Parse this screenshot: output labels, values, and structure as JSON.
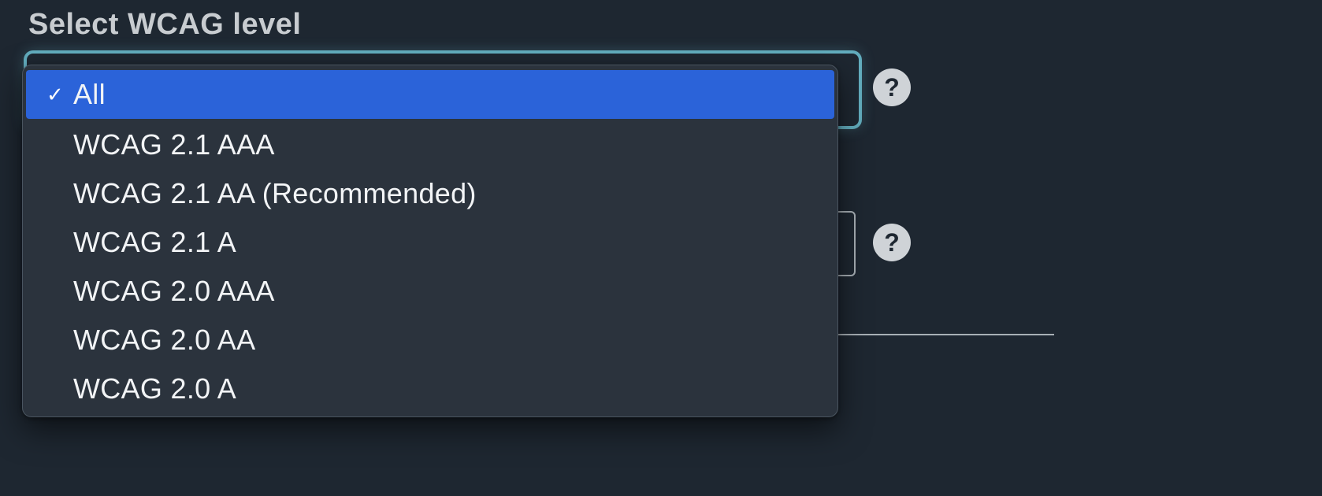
{
  "field1": {
    "label": "Select WCAG level",
    "selected_index": 0,
    "options": [
      "All",
      "WCAG 2.1 AAA",
      "WCAG 2.1 AA (Recommended)",
      "WCAG 2.1 A",
      "WCAG 2.0 AAA",
      "WCAG 2.0 AA",
      "WCAG 2.0 A"
    ]
  },
  "help_glyph": "?"
}
